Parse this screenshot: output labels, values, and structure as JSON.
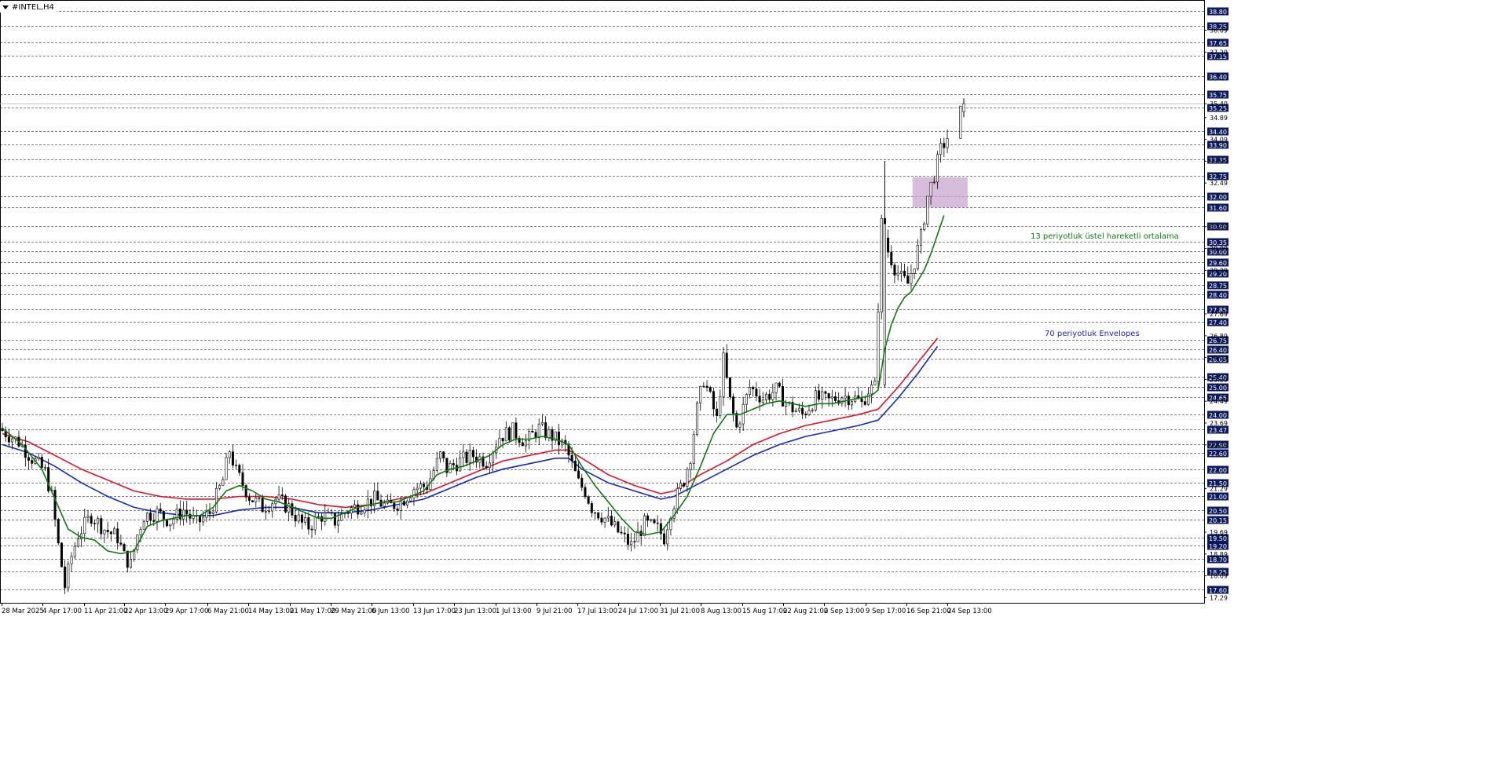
{
  "window": {
    "title": "#INTEL,H4"
  },
  "colors": {
    "background": "#ffffff",
    "grid_dash": "#000000",
    "candle": "#000000",
    "ema13": "#0a7d0a",
    "envelope_upper": "#e8102a",
    "envelope_lower": "#1428c8",
    "axis_label_bg": "#0b1a5c",
    "axis_label_text": "#ffffff",
    "zone_fill": "#c9a6cf",
    "annotation_green": "#0a7d0a",
    "annotation_blue": "#1428c8"
  },
  "annotations": {
    "ema": "13 periyotluk üstel hareketli ortalama",
    "envelopes": "70 periyotluk Envelopes"
  },
  "chart_data": {
    "type": "candlestick",
    "symbol": "#INTEL",
    "timeframe": "H4",
    "ylim": [
      17.1,
      39.2
    ],
    "grid": true,
    "price_levels": [
      38.8,
      38.25,
      37.65,
      37.15,
      36.4,
      35.75,
      35.25,
      34.4,
      33.9,
      33.35,
      32.75,
      32.0,
      31.6,
      30.9,
      30.35,
      30.0,
      29.6,
      29.2,
      28.75,
      28.4,
      27.85,
      27.4,
      26.75,
      26.4,
      26.05,
      25.4,
      25.0,
      24.65,
      24.0,
      23.47,
      22.9,
      22.6,
      22.0,
      21.5,
      21.0,
      20.5,
      20.15,
      19.5,
      19.2,
      18.7,
      18.25,
      17.6
    ],
    "axis_ticks": [
      38.09,
      37.29,
      35.4,
      34.89,
      34.09,
      33.29,
      32.49,
      30.89,
      30.09,
      29.29,
      27.69,
      26.89,
      26.09,
      25.29,
      24.49,
      23.69,
      22.89,
      21.29,
      19.69,
      18.89,
      18.09,
      17.29
    ],
    "current_price": 35.4,
    "x_labels": [
      "28 Mar 2025",
      "4 Apr 17:00",
      "11 Apr 21:00",
      "22 Apr 13:00",
      "29 Apr 17:00",
      "6 May 21:00",
      "14 May 13:00",
      "21 May 17:00",
      "29 May 21:00",
      "6 Jun 13:00",
      "13 Jun 17:00",
      "23 Jun 13:00",
      "1 Jul 13:00",
      "9 Jul 21:00",
      "17 Jul 13:00",
      "24 Jul 17:00",
      "31 Jul 21:00",
      "8 Aug 13:00",
      "15 Aug 17:00",
      "22 Aug 21:00",
      "2 Sep 13:00",
      "9 Sep 17:00",
      "16 Sep 21:00",
      "24 Sep 13:00"
    ],
    "price_path": [
      [
        0,
        23.5
      ],
      [
        3,
        23.0
      ],
      [
        5,
        22.4
      ],
      [
        7,
        21.9
      ],
      [
        8,
        21.0
      ],
      [
        9,
        19.2
      ],
      [
        10,
        17.7
      ],
      [
        11,
        18.8
      ],
      [
        12,
        19.6
      ],
      [
        14,
        20.3
      ],
      [
        16,
        19.8
      ],
      [
        18,
        19.5
      ],
      [
        19,
        18.8
      ],
      [
        20,
        18.5
      ],
      [
        21,
        19.6
      ],
      [
        22,
        20.3
      ],
      [
        24,
        20.4
      ],
      [
        26,
        20.1
      ],
      [
        28,
        20.5
      ],
      [
        30,
        20.0
      ],
      [
        32,
        20.4
      ],
      [
        34,
        21.6
      ],
      [
        35,
        22.7
      ],
      [
        36,
        21.9
      ],
      [
        38,
        21.0
      ],
      [
        40,
        20.6
      ],
      [
        42,
        20.9
      ],
      [
        44,
        20.6
      ],
      [
        46,
        20.0
      ],
      [
        47,
        19.9
      ],
      [
        49,
        20.3
      ],
      [
        51,
        20.1
      ],
      [
        53,
        20.5
      ],
      [
        55,
        20.7
      ],
      [
        57,
        20.9
      ],
      [
        59,
        20.6
      ],
      [
        61,
        20.8
      ],
      [
        63,
        21.3
      ],
      [
        65,
        21.4
      ],
      [
        67,
        22.5
      ],
      [
        68,
        22.0
      ],
      [
        70,
        22.3
      ],
      [
        72,
        22.5
      ],
      [
        74,
        22.3
      ],
      [
        76,
        23.2
      ],
      [
        78,
        23.4
      ],
      [
        80,
        23.0
      ],
      [
        82,
        23.5
      ],
      [
        84,
        23.2
      ],
      [
        86,
        22.8
      ],
      [
        88,
        21.5
      ],
      [
        89,
        21.2
      ],
      [
        90,
        20.6
      ],
      [
        92,
        20.2
      ],
      [
        94,
        19.7
      ],
      [
        96,
        19.2
      ],
      [
        98,
        20.0
      ],
      [
        100,
        19.8
      ],
      [
        101,
        19.5
      ],
      [
        102,
        20.5
      ],
      [
        104,
        21.6
      ],
      [
        105,
        22.5
      ],
      [
        106,
        24.2
      ],
      [
        107,
        25.3
      ],
      [
        108,
        24.6
      ],
      [
        109,
        23.8
      ],
      [
        110,
        26.0
      ],
      [
        111,
        24.5
      ],
      [
        112,
        23.5
      ],
      [
        114,
        25.0
      ],
      [
        116,
        24.6
      ],
      [
        118,
        24.9
      ],
      [
        120,
        24.3
      ],
      [
        122,
        24.0
      ],
      [
        124,
        24.6
      ],
      [
        126,
        24.5
      ],
      [
        128,
        24.7
      ],
      [
        130,
        24.6
      ],
      [
        131,
        24.4
      ],
      [
        132,
        24.9
      ],
      [
        133,
        25.0
      ],
      [
        134,
        31.0
      ],
      [
        135,
        30.0
      ],
      [
        136,
        29.4
      ],
      [
        137,
        29.0
      ],
      [
        138,
        28.8
      ],
      [
        139,
        29.6
      ],
      [
        140,
        30.5
      ],
      [
        141,
        32.0
      ],
      [
        142,
        32.8
      ],
      [
        143,
        33.7
      ],
      [
        146,
        35.1
      ]
    ],
    "ema13_path": [
      [
        0,
        23.5
      ],
      [
        3,
        22.9
      ],
      [
        6,
        22.0
      ],
      [
        8,
        20.9
      ],
      [
        10,
        19.8
      ],
      [
        12,
        19.5
      ],
      [
        14,
        19.4
      ],
      [
        16,
        19.0
      ],
      [
        18,
        18.9
      ],
      [
        20,
        19.0
      ],
      [
        22,
        19.9
      ],
      [
        24,
        20.1
      ],
      [
        26,
        20.2
      ],
      [
        28,
        20.3
      ],
      [
        30,
        20.3
      ],
      [
        32,
        20.6
      ],
      [
        34,
        21.2
      ],
      [
        36,
        21.4
      ],
      [
        38,
        21.2
      ],
      [
        40,
        20.9
      ],
      [
        42,
        20.8
      ],
      [
        44,
        20.6
      ],
      [
        46,
        20.4
      ],
      [
        48,
        20.2
      ],
      [
        50,
        20.2
      ],
      [
        52,
        20.4
      ],
      [
        54,
        20.6
      ],
      [
        56,
        20.7
      ],
      [
        58,
        20.8
      ],
      [
        60,
        20.8
      ],
      [
        62,
        21.0
      ],
      [
        64,
        21.2
      ],
      [
        66,
        21.8
      ],
      [
        68,
        22.0
      ],
      [
        70,
        22.1
      ],
      [
        72,
        22.3
      ],
      [
        74,
        22.5
      ],
      [
        76,
        22.9
      ],
      [
        78,
        23.1
      ],
      [
        80,
        23.1
      ],
      [
        82,
        23.2
      ],
      [
        84,
        23.1
      ],
      [
        86,
        22.9
      ],
      [
        88,
        22.1
      ],
      [
        90,
        21.4
      ],
      [
        92,
        20.8
      ],
      [
        94,
        20.2
      ],
      [
        96,
        19.7
      ],
      [
        98,
        19.6
      ],
      [
        100,
        19.7
      ],
      [
        102,
        20.3
      ],
      [
        104,
        21.0
      ],
      [
        106,
        22.1
      ],
      [
        108,
        23.3
      ],
      [
        110,
        24.0
      ],
      [
        112,
        24.0
      ],
      [
        114,
        24.2
      ],
      [
        116,
        24.4
      ],
      [
        118,
        24.5
      ],
      [
        120,
        24.4
      ],
      [
        122,
        24.3
      ],
      [
        124,
        24.4
      ],
      [
        126,
        24.4
      ],
      [
        128,
        24.5
      ],
      [
        130,
        24.6
      ],
      [
        132,
        24.7
      ],
      [
        133,
        24.9
      ],
      [
        134,
        26.4
      ],
      [
        135,
        27.3
      ],
      [
        136,
        27.9
      ],
      [
        137,
        28.3
      ],
      [
        138,
        28.5
      ],
      [
        139,
        28.9
      ],
      [
        140,
        29.3
      ],
      [
        141,
        29.9
      ],
      [
        142,
        30.6
      ],
      [
        143,
        31.3
      ]
    ],
    "envelope_upper_path": [
      [
        0,
        23.3
      ],
      [
        4,
        23.0
      ],
      [
        8,
        22.5
      ],
      [
        12,
        22.0
      ],
      [
        16,
        21.6
      ],
      [
        20,
        21.2
      ],
      [
        24,
        21.0
      ],
      [
        28,
        20.9
      ],
      [
        32,
        20.9
      ],
      [
        36,
        21.0
      ],
      [
        40,
        21.0
      ],
      [
        44,
        20.9
      ],
      [
        48,
        20.7
      ],
      [
        52,
        20.6
      ],
      [
        56,
        20.7
      ],
      [
        60,
        20.9
      ],
      [
        64,
        21.1
      ],
      [
        68,
        21.5
      ],
      [
        72,
        21.9
      ],
      [
        76,
        22.3
      ],
      [
        80,
        22.5
      ],
      [
        84,
        22.7
      ],
      [
        86,
        22.7
      ],
      [
        88,
        22.4
      ],
      [
        92,
        21.8
      ],
      [
        96,
        21.4
      ],
      [
        100,
        21.1
      ],
      [
        102,
        21.2
      ],
      [
        106,
        21.8
      ],
      [
        110,
        22.3
      ],
      [
        114,
        22.9
      ],
      [
        118,
        23.3
      ],
      [
        122,
        23.6
      ],
      [
        126,
        23.8
      ],
      [
        130,
        24.0
      ],
      [
        133,
        24.2
      ],
      [
        136,
        25.0
      ],
      [
        139,
        25.9
      ],
      [
        142,
        26.8
      ]
    ],
    "envelope_lower_path": [
      [
        0,
        22.9
      ],
      [
        4,
        22.6
      ],
      [
        8,
        22.1
      ],
      [
        12,
        21.5
      ],
      [
        16,
        21.0
      ],
      [
        20,
        20.6
      ],
      [
        24,
        20.4
      ],
      [
        28,
        20.3
      ],
      [
        32,
        20.3
      ],
      [
        36,
        20.5
      ],
      [
        40,
        20.6
      ],
      [
        44,
        20.6
      ],
      [
        48,
        20.4
      ],
      [
        52,
        20.4
      ],
      [
        56,
        20.5
      ],
      [
        60,
        20.7
      ],
      [
        64,
        20.9
      ],
      [
        68,
        21.3
      ],
      [
        72,
        21.7
      ],
      [
        76,
        22.0
      ],
      [
        80,
        22.2
      ],
      [
        84,
        22.4
      ],
      [
        86,
        22.4
      ],
      [
        88,
        22.0
      ],
      [
        92,
        21.5
      ],
      [
        96,
        21.2
      ],
      [
        100,
        20.9
      ],
      [
        102,
        21.0
      ],
      [
        106,
        21.5
      ],
      [
        110,
        22.0
      ],
      [
        114,
        22.5
      ],
      [
        118,
        22.9
      ],
      [
        122,
        23.2
      ],
      [
        126,
        23.4
      ],
      [
        130,
        23.6
      ],
      [
        133,
        23.8
      ],
      [
        136,
        24.6
      ],
      [
        139,
        25.5
      ],
      [
        142,
        26.5
      ]
    ],
    "zone": {
      "x_range": [
        140,
        143
      ],
      "y_range": [
        31.6,
        32.7
      ]
    }
  }
}
